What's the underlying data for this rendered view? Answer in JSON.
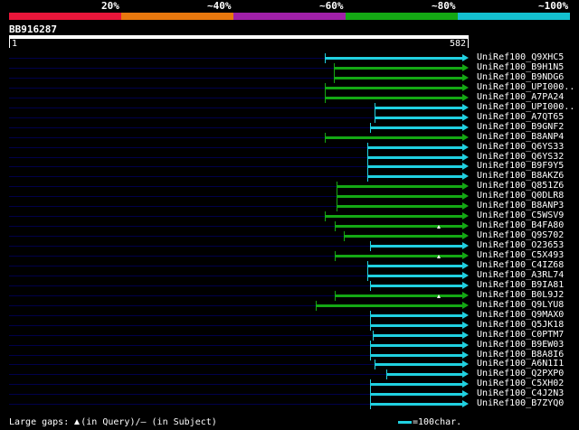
{
  "identity_scale": {
    "labels": [
      "20%",
      "~40%",
      "~60%",
      "~80%",
      "~100%"
    ],
    "colors": [
      "#e8163a",
      "#e8780e",
      "#a020a8",
      "#14a814",
      "#14c0d0"
    ]
  },
  "query": {
    "name": "BB916287",
    "start": "1",
    "end": "582",
    "length": 582
  },
  "hit_colors": {
    "baseline": "#00004a",
    "green": "#14a814",
    "cyan": "#20d0e0"
  },
  "hits": [
    {
      "label": "UniRef100_Q9XHC5",
      "start": 400,
      "color": "cyan",
      "gap": null
    },
    {
      "label": "UniRef100_B9H1N5",
      "start": 411,
      "color": "green",
      "gap": null
    },
    {
      "label": "UniRef100_B9NDG6",
      "start": 411,
      "color": "green",
      "gap": null
    },
    {
      "label": "UniRef100_UPI000..",
      "start": 400,
      "color": "green",
      "gap": null
    },
    {
      "label": "UniRef100_A7PA24",
      "start": 400,
      "color": "green",
      "gap": null
    },
    {
      "label": "UniRef100_UPI000..",
      "start": 463,
      "color": "cyan",
      "gap": null
    },
    {
      "label": "UniRef100_A7QT65",
      "start": 463,
      "color": "cyan",
      "gap": null
    },
    {
      "label": "UniRef100_B9GNF2",
      "start": 457,
      "color": "cyan",
      "gap": null
    },
    {
      "label": "UniRef100_B8ANP4",
      "start": 400,
      "color": "green",
      "gap": null
    },
    {
      "label": "UniRef100_Q6YS33",
      "start": 454,
      "color": "cyan",
      "gap": null
    },
    {
      "label": "UniRef100_Q6YS32",
      "start": 454,
      "color": "cyan",
      "gap": null
    },
    {
      "label": "UniRef100_B9F9Y5",
      "start": 454,
      "color": "cyan",
      "gap": null
    },
    {
      "label": "UniRef100_B8AKZ6",
      "start": 454,
      "color": "cyan",
      "gap": null
    },
    {
      "label": "UniRef100_Q851Z6",
      "start": 415,
      "color": "green",
      "gap": null
    },
    {
      "label": "UniRef100_Q0DLR8",
      "start": 415,
      "color": "green",
      "gap": null
    },
    {
      "label": "UniRef100_B8ANP3",
      "start": 415,
      "color": "green",
      "gap": null
    },
    {
      "label": "UniRef100_C5WSV9",
      "start": 400,
      "color": "green",
      "gap": null
    },
    {
      "label": "UniRef100_B4FA80",
      "start": 412,
      "color": "green",
      "gap": 544
    },
    {
      "label": "UniRef100_Q9S702",
      "start": 424,
      "color": "green",
      "gap": null
    },
    {
      "label": "UniRef100_O23653",
      "start": 457,
      "color": "cyan",
      "gap": null
    },
    {
      "label": "UniRef100_C5X493",
      "start": 412,
      "color": "green",
      "gap": 544
    },
    {
      "label": "UniRef100_C4IZ68",
      "start": 454,
      "color": "cyan",
      "gap": null
    },
    {
      "label": "UniRef100_A3RL74",
      "start": 454,
      "color": "cyan",
      "gap": null
    },
    {
      "label": "UniRef100_B9IA81",
      "start": 457,
      "color": "cyan",
      "gap": null
    },
    {
      "label": "UniRef100_B0L9J2",
      "start": 412,
      "color": "green",
      "gap": 544
    },
    {
      "label": "UniRef100_Q9LYU8",
      "start": 388,
      "color": "green",
      "gap": null
    },
    {
      "label": "UniRef100_Q9MAX0",
      "start": 457,
      "color": "cyan",
      "gap": null
    },
    {
      "label": "UniRef100_Q5JK18",
      "start": 457,
      "color": "cyan",
      "gap": null
    },
    {
      "label": "UniRef100_C0PTM7",
      "start": 461,
      "color": "cyan",
      "gap": null
    },
    {
      "label": "UniRef100_B9EW03",
      "start": 457,
      "color": "cyan",
      "gap": null
    },
    {
      "label": "UniRef100_B8A8I6",
      "start": 457,
      "color": "cyan",
      "gap": null
    },
    {
      "label": "UniRef100_A6N1I1",
      "start": 463,
      "color": "cyan",
      "gap": null
    },
    {
      "label": "UniRef100_Q2PXP0",
      "start": 478,
      "color": "cyan",
      "gap": null
    },
    {
      "label": "UniRef100_C5XH02",
      "start": 457,
      "color": "cyan",
      "gap": null
    },
    {
      "label": "UniRef100_C4J2N3",
      "start": 457,
      "color": "cyan",
      "gap": null
    },
    {
      "label": "UniRef100_B7ZYQ0",
      "start": 457,
      "color": "cyan",
      "gap": null
    }
  ],
  "footer": {
    "gaps_prefix": "Large gaps:",
    "gaps_text": "(in Query)/— (in Subject)",
    "scale_text": "=100char."
  }
}
